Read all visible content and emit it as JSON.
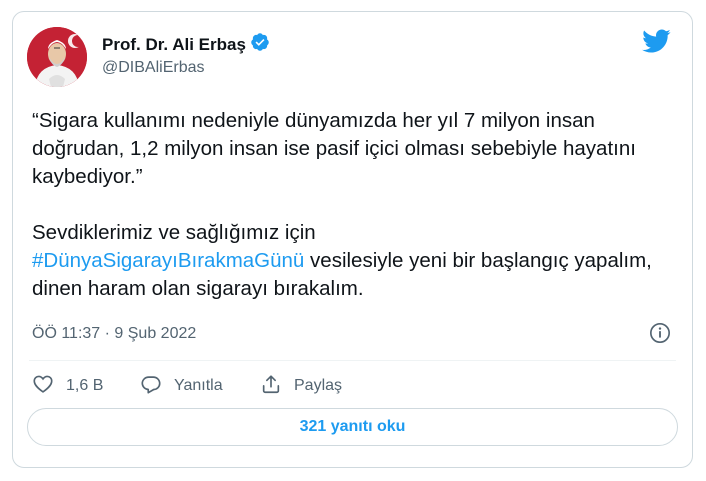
{
  "author": {
    "name": "Prof. Dr. Ali Erbaş",
    "handle": "@DIBAliErbas",
    "verified": true
  },
  "tweet": {
    "line1": "“Sigara kullanımı nedeniyle dünyamızda her yıl 7 milyon insan doğrudan, 1,2 milyon insan ise pasif içici olması sebebiyle hayatını kaybediyor.”",
    "line2_prefix": "Sevdiklerimiz ve sağlığımız için",
    "hashtag": "#DünyaSigarayıBırakmaGünü",
    "line2_suffix": " vesilesiyle yeni bir başlangıç yapalım, dinen haram olan sigarayı bırakalım."
  },
  "timestamp": "ÖÖ 11:37 · 9 Şub 2022",
  "actions": {
    "like_count": "1,6 B",
    "reply_label": "Yanıtla",
    "share_label": "Paylaş"
  },
  "read_replies_label": "321 yanıtı oku",
  "colors": {
    "accent": "#1d9bf0",
    "text": "#0f1419",
    "muted": "#536471",
    "border": "#cfd9de"
  },
  "icons": [
    "verified-badge-icon",
    "twitter-logo-icon",
    "info-icon",
    "heart-icon",
    "reply-icon",
    "share-icon"
  ]
}
